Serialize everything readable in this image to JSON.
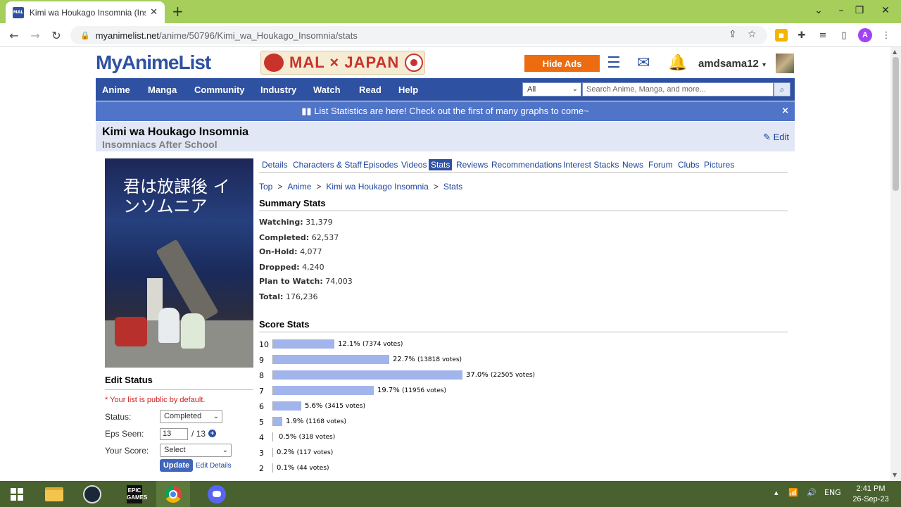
{
  "browser": {
    "tab_title": "Kimi wa Houkago Insomnia (Inso",
    "tab_favicon": "MAL",
    "url_host": "myanimelist.net",
    "url_path": "/anime/50796/Kimi_wa_Houkago_Insomnia/stats",
    "profile_initial": "A"
  },
  "header": {
    "logo": "MyAnimeList",
    "banner_text": "MAL × JAPAN",
    "hide_ads": "Hide Ads",
    "username": "amdsama12"
  },
  "nav": {
    "items": [
      "Anime",
      "Manga",
      "Community",
      "Industry",
      "Watch",
      "Read",
      "Help"
    ],
    "search_category": "All",
    "search_placeholder": "Search Anime, Manga, and more..."
  },
  "notice": {
    "text": "List Statistics are here! Check out the first of many graphs to come~",
    "close": "×"
  },
  "title": {
    "main": "Kimi wa Houkago Insomnia",
    "english": "Insomniacs After School",
    "edit": "Edit"
  },
  "poster": {
    "title": "君は放課後 インソムニア"
  },
  "edit_status": {
    "heading": "Edit Status",
    "public_note": "* Your list is public by default.",
    "status_label": "Status:",
    "status_value": "Completed",
    "eps_label": "Eps Seen:",
    "eps_value": "13",
    "eps_total": "/ 13",
    "score_label": "Your Score:",
    "score_value": "Select",
    "update": "Update",
    "edit_details": "Edit Details"
  },
  "subnav": {
    "items": [
      "Details",
      "Characters & Staff",
      "Episodes",
      "Videos",
      "Stats",
      "Reviews",
      "Recommendations",
      "Interest Stacks",
      "News",
      "Forum",
      "Clubs",
      "Pictures"
    ],
    "active": "Stats"
  },
  "breadcrumb": {
    "items": [
      "Top",
      "Anime",
      "Kimi wa Houkago Insomnia",
      "Stats"
    ],
    "sep": ">"
  },
  "summary": {
    "heading": "Summary Stats",
    "rows": [
      {
        "label": "Watching:",
        "value": "31,379"
      },
      {
        "label": "Completed:",
        "value": "62,537"
      },
      {
        "label": "On-Hold:",
        "value": "4,077"
      },
      {
        "label": "Dropped:",
        "value": "4,240"
      },
      {
        "label": "Plan to Watch:",
        "value": "74,003"
      },
      {
        "label": "Total:",
        "value": "176,236"
      }
    ]
  },
  "score_stats": {
    "heading": "Score Stats",
    "rows": [
      {
        "score": "10",
        "pct": 12.1,
        "pct_label": "12.1%",
        "votes": "(7374 votes)"
      },
      {
        "score": "9",
        "pct": 22.7,
        "pct_label": "22.7%",
        "votes": "(13818 votes)"
      },
      {
        "score": "8",
        "pct": 37.0,
        "pct_label": "37.0%",
        "votes": "(22505 votes)"
      },
      {
        "score": "7",
        "pct": 19.7,
        "pct_label": "19.7%",
        "votes": "(11956 votes)"
      },
      {
        "score": "6",
        "pct": 5.6,
        "pct_label": "5.6%",
        "votes": "(3415 votes)"
      },
      {
        "score": "5",
        "pct": 1.9,
        "pct_label": "1.9%",
        "votes": "(1168 votes)"
      },
      {
        "score": "4",
        "pct": 0.5,
        "pct_label": "0.5%",
        "votes": "(318 votes)"
      },
      {
        "score": "3",
        "pct": 0.2,
        "pct_label": "0.2%",
        "votes": "(117 votes)"
      },
      {
        "score": "2",
        "pct": 0.1,
        "pct_label": "0.1%",
        "votes": "(44 votes)"
      }
    ]
  },
  "taskbar": {
    "epic_label": "EPIC GAMES",
    "lang": "ENG",
    "time": "2:41 PM",
    "date": "26-Sep-23"
  },
  "colors": {
    "brand": "#2e51a2",
    "bar": "#a2b4ec",
    "hide_ads": "#ec6c0f",
    "tab_strip": "#a5ce5a"
  }
}
